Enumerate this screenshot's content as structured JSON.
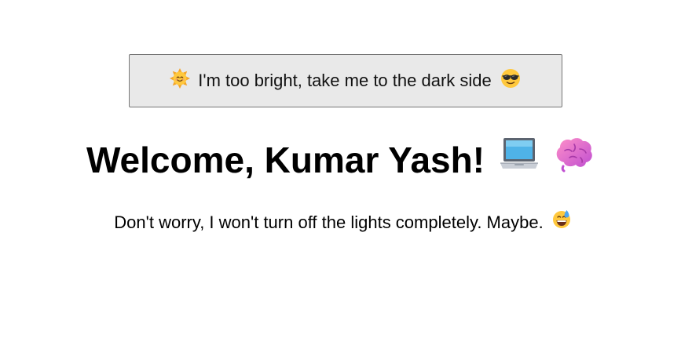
{
  "toggle_button": {
    "label": "I'm too bright, take me to the dark side",
    "leading_icon": "smiling-sun-icon",
    "trailing_icon": "sunglasses-face-icon"
  },
  "welcome": {
    "title": "Welcome, Kumar Yash!",
    "icons": [
      "laptop-icon",
      "brain-icon"
    ]
  },
  "message": {
    "text": "Don't worry, I won't turn off the lights completely. Maybe.",
    "icon": "grinning-sweat-face-icon"
  },
  "colors": {
    "button_bg": "#e9e9e9",
    "button_border": "#767676",
    "text": "#000000",
    "page_bg": "#ffffff"
  }
}
